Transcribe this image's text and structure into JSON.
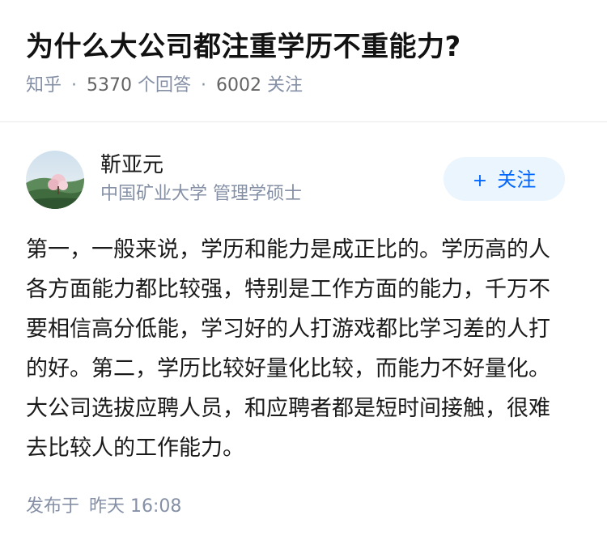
{
  "question": {
    "title": "为什么大公司都注重学历不重能力?",
    "source": "知乎",
    "answer_count": "5370",
    "answer_label": "个回答",
    "follower_count": "6002",
    "follower_label": "关注",
    "separator": "·"
  },
  "author": {
    "name": "靳亚元",
    "bio": "中国矿业大学 管理学硕士",
    "follow_label": "关注",
    "follow_icon": "plus-icon",
    "follow_symbol": "+"
  },
  "answer": {
    "content": "第一，一般来说，学历和能力是成正比的。学历高的人各方面能力都比较强，特别是工作方面的能力，千万不要相信高分低能，学习好的人打游戏都比学习差的人打的好。第二，学历比较好量化比较，而能力不好量化。大公司选拔应聘人员，和应聘者都是短时间接触，很难去比较人的工作能力。"
  },
  "meta": {
    "published_label": "发布于",
    "published_time": "昨天 16:08"
  },
  "colors": {
    "meta_gray": "#8590a6",
    "accent_blue": "#0066ff",
    "follow_bg": "#ebf5fd"
  }
}
